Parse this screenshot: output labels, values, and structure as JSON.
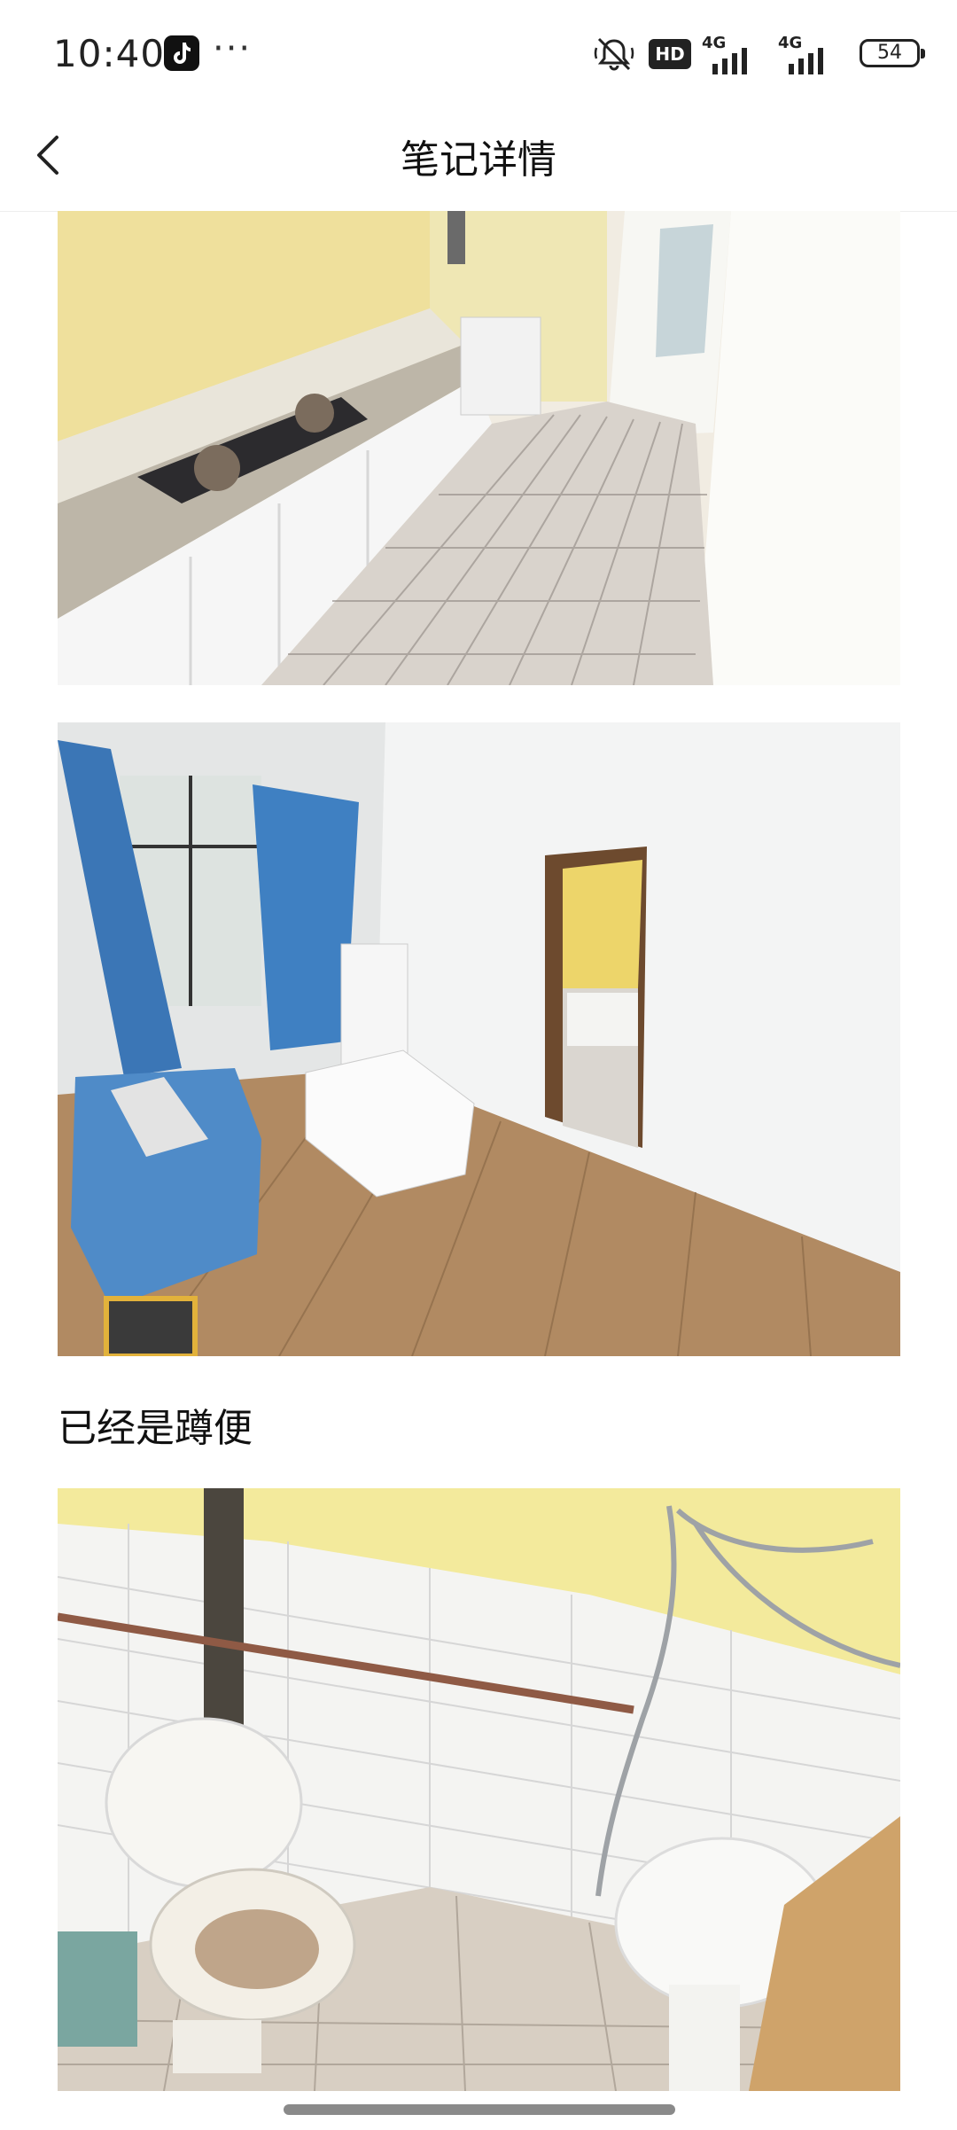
{
  "status_bar": {
    "time": "10:40",
    "more": "···",
    "hd": "HD",
    "network_1": "4G",
    "network_2": "4G",
    "battery": "54"
  },
  "header": {
    "title": "笔记详情"
  },
  "content": {
    "caption": "已经是蹲便"
  }
}
